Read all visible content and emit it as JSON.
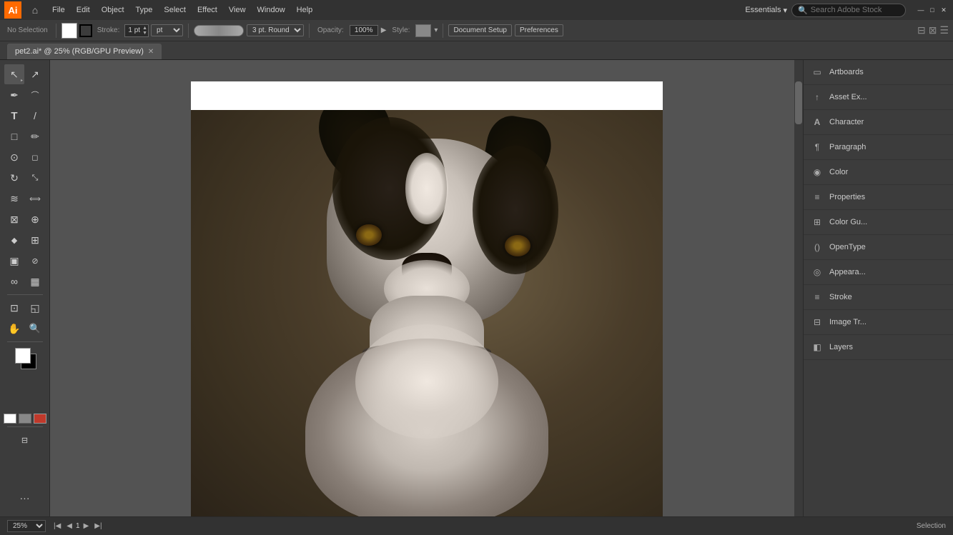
{
  "app": {
    "name": "Adobe Illustrator",
    "logo_text": "Ai",
    "logo_bg": "#FF6A00"
  },
  "menubar": {
    "items": [
      "File",
      "Edit",
      "Object",
      "Type",
      "Select",
      "Effect",
      "View",
      "Window",
      "Help"
    ],
    "workspace": "Essentials",
    "search_placeholder": "Search Adobe Stock",
    "win_minimize": "—",
    "win_maximize": "□",
    "win_close": "✕"
  },
  "toolbar": {
    "selection_label": "No Selection",
    "stroke_label": "Stroke:",
    "stroke_value": "1 pt",
    "brush_size": "3 pt. Round",
    "opacity_label": "Opacity:",
    "opacity_value": "100%",
    "style_label": "Style:",
    "doc_setup_btn": "Document Setup",
    "prefs_btn": "Preferences"
  },
  "tab": {
    "title": "pet2.ai* @ 25% (RGB/GPU Preview)",
    "close": "✕"
  },
  "tools": {
    "items": [
      {
        "name": "selection",
        "icon": "↖",
        "label": "Selection Tool"
      },
      {
        "name": "direct-selection",
        "icon": "↗",
        "label": "Direct Selection Tool"
      },
      {
        "name": "pen",
        "icon": "✒",
        "label": "Pen Tool"
      },
      {
        "name": "curvature",
        "icon": "⌒",
        "label": "Curvature Tool"
      },
      {
        "name": "type",
        "icon": "T",
        "label": "Type Tool"
      },
      {
        "name": "line",
        "icon": "/",
        "label": "Line Segment Tool"
      },
      {
        "name": "rectangle",
        "icon": "□",
        "label": "Rectangle Tool"
      },
      {
        "name": "paintbrush",
        "icon": "✏",
        "label": "Paintbrush Tool"
      },
      {
        "name": "blob-brush",
        "icon": "⊙",
        "label": "Blob Brush Tool"
      },
      {
        "name": "eraser",
        "icon": "◻",
        "label": "Eraser Tool"
      },
      {
        "name": "rotate",
        "icon": "↻",
        "label": "Rotate Tool"
      },
      {
        "name": "scale",
        "icon": "⤡",
        "label": "Scale Tool"
      },
      {
        "name": "warp",
        "icon": "≋",
        "label": "Warp Tool"
      },
      {
        "name": "width",
        "icon": "⟺",
        "label": "Width Tool"
      },
      {
        "name": "free-transform",
        "icon": "⊠",
        "label": "Free Transform Tool"
      },
      {
        "name": "shape-builder",
        "icon": "⊕",
        "label": "Shape Builder Tool"
      },
      {
        "name": "perspective",
        "icon": "◆",
        "label": "Perspective Tool"
      },
      {
        "name": "mesh",
        "icon": "⊞",
        "label": "Mesh Tool"
      },
      {
        "name": "gradient",
        "icon": "▣",
        "label": "Gradient Tool"
      },
      {
        "name": "eyedropper",
        "icon": "⊘",
        "label": "Eyedropper Tool"
      },
      {
        "name": "blend",
        "icon": "∞",
        "label": "Blend Tool"
      },
      {
        "name": "graph",
        "icon": "▦",
        "label": "Graph Tool"
      },
      {
        "name": "artboard",
        "icon": "⊡",
        "label": "Artboard Tool"
      },
      {
        "name": "slice",
        "icon": "◱",
        "label": "Slice Tool"
      },
      {
        "name": "zoom",
        "icon": "⊕",
        "label": "Zoom Tool"
      },
      {
        "name": "hand",
        "icon": "✋",
        "label": "Hand Tool"
      }
    ]
  },
  "right_panels": {
    "items": [
      {
        "name": "artboards",
        "label": "Artboards",
        "icon": "▭"
      },
      {
        "name": "asset-export",
        "label": "Asset Ex...",
        "icon": "↑"
      },
      {
        "name": "character",
        "label": "Character",
        "icon": "A"
      },
      {
        "name": "paragraph",
        "label": "Paragraph",
        "icon": "¶"
      },
      {
        "name": "color",
        "label": "Color",
        "icon": "◉"
      },
      {
        "name": "properties",
        "label": "Properties",
        "icon": "≡"
      },
      {
        "name": "color-guide",
        "label": "Color Gu...",
        "icon": "⊞"
      },
      {
        "name": "opentype",
        "label": "OpenType",
        "icon": "()"
      },
      {
        "name": "appearance",
        "label": "Appeara...",
        "icon": "◎"
      },
      {
        "name": "stroke",
        "label": "Stroke",
        "icon": "≡"
      },
      {
        "name": "image-trace",
        "label": "Image Tr...",
        "icon": "⊟"
      },
      {
        "name": "layers",
        "label": "Layers",
        "icon": "◧"
      }
    ]
  },
  "statusbar": {
    "zoom": "25%",
    "page_label": "1",
    "tool_name": "Selection",
    "nav_prev": "◀",
    "nav_next": "▶",
    "nav_first": "|◀",
    "nav_last": "▶|"
  }
}
